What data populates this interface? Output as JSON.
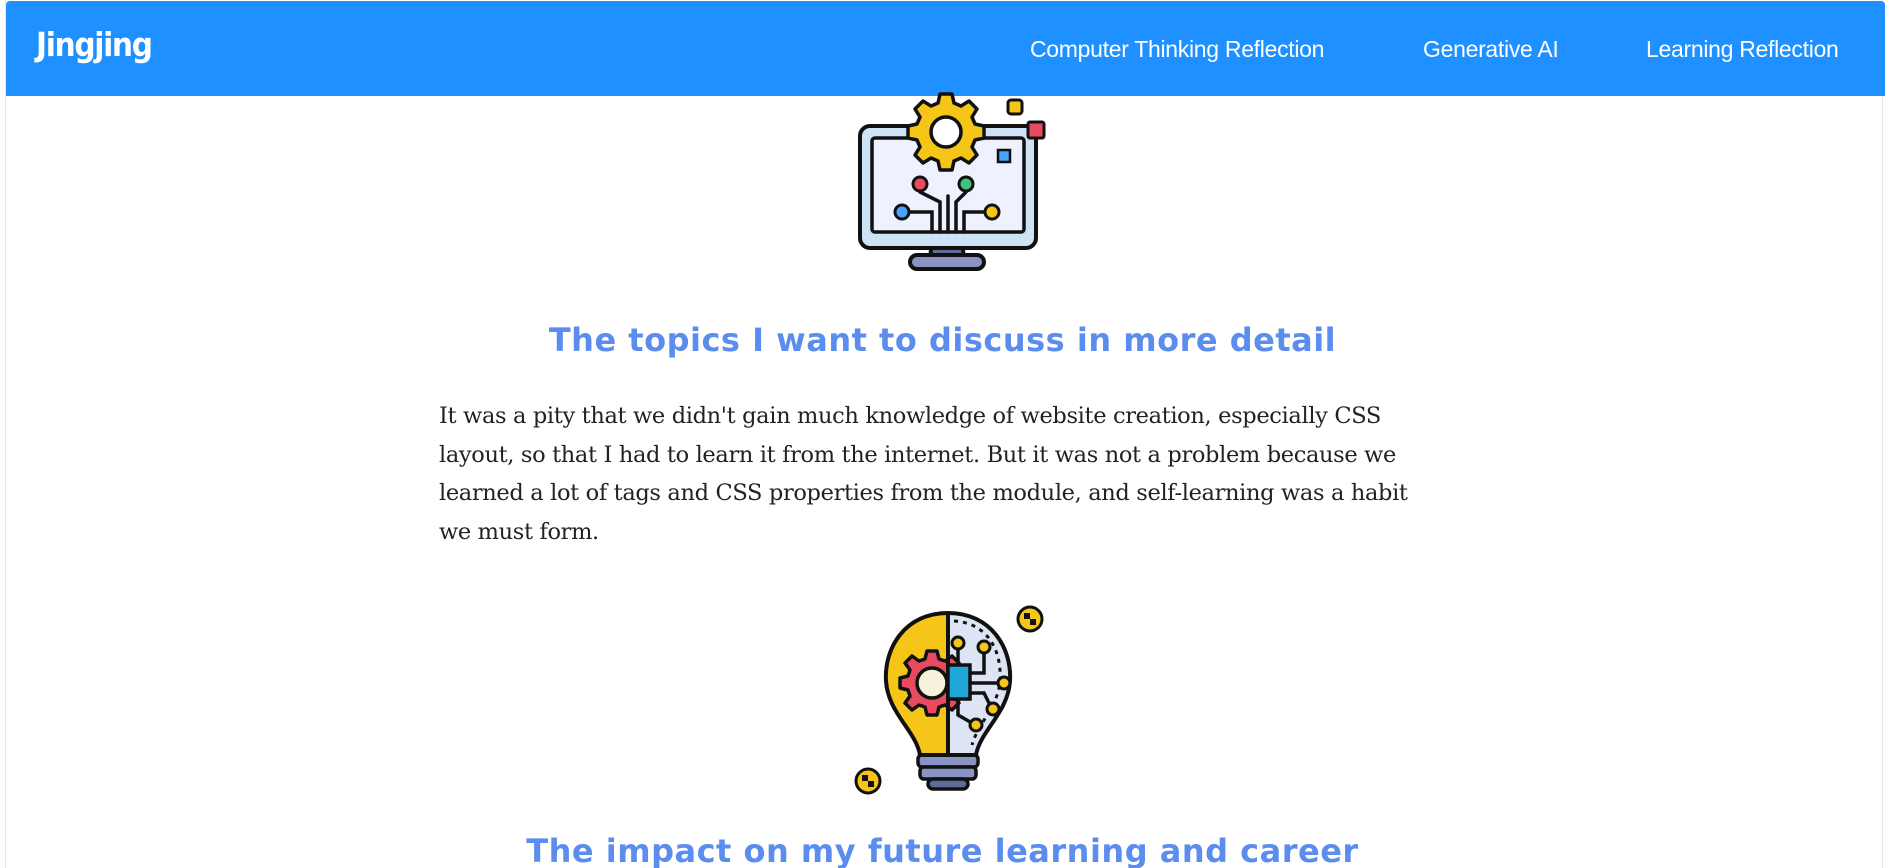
{
  "navbar": {
    "brand": "Jingjing",
    "links": [
      {
        "label": "Computer Thinking Reflection"
      },
      {
        "label": "Generative AI"
      },
      {
        "label": "Learning Reflection"
      }
    ],
    "background_color": "#1e90ff"
  },
  "sections": [
    {
      "icon": "computer-gear-circuit-icon",
      "heading": "The topics I want to discuss in more detail",
      "body": "It was a pity that we didn't gain much knowledge of website creation, especially CSS layout, so that I had to learn it from the internet. But it was not a problem because we learned a lot of tags and CSS properties from the module, and self-learning was a habit we must form."
    },
    {
      "icon": "lightbulb-gear-circuit-icon",
      "heading": "The impact on my future learning and career"
    }
  ],
  "colors": {
    "heading": "#5b8def",
    "body_text": "#222222"
  }
}
